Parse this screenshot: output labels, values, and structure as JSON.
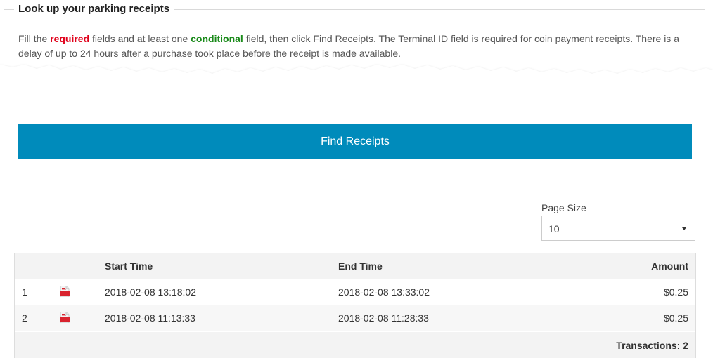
{
  "form": {
    "legend": "Look up your parking receipts",
    "intro": {
      "part1": "Fill the ",
      "required": "required",
      "part2": " fields and at least one ",
      "conditional": "conditional",
      "part3": " field, then click Find Receipts. The Terminal ID field is required for coin payment receipts. There is a delay of up to 24 hours after a purchase took place before the receipt is made available."
    },
    "find_button": "Find Receipts"
  },
  "page_size": {
    "label": "Page Size",
    "value": "10"
  },
  "table": {
    "columns": {
      "start": "Start Time",
      "end": "End Time",
      "amount": "Amount"
    },
    "rows": [
      {
        "index": "1",
        "icon": "pdf-icon",
        "start": "2018-02-08 13:18:02",
        "end": "2018-02-08 13:33:02",
        "amount": "$0.25"
      },
      {
        "index": "2",
        "icon": "pdf-icon",
        "start": "2018-02-08 11:13:33",
        "end": "2018-02-08 11:28:33",
        "amount": "$0.25"
      }
    ],
    "footer": "Transactions: 2"
  },
  "colors": {
    "button": "#008bbb",
    "required": "#e0001a",
    "conditional": "#1a8a1a",
    "pdf_icon": "#d9232e"
  }
}
